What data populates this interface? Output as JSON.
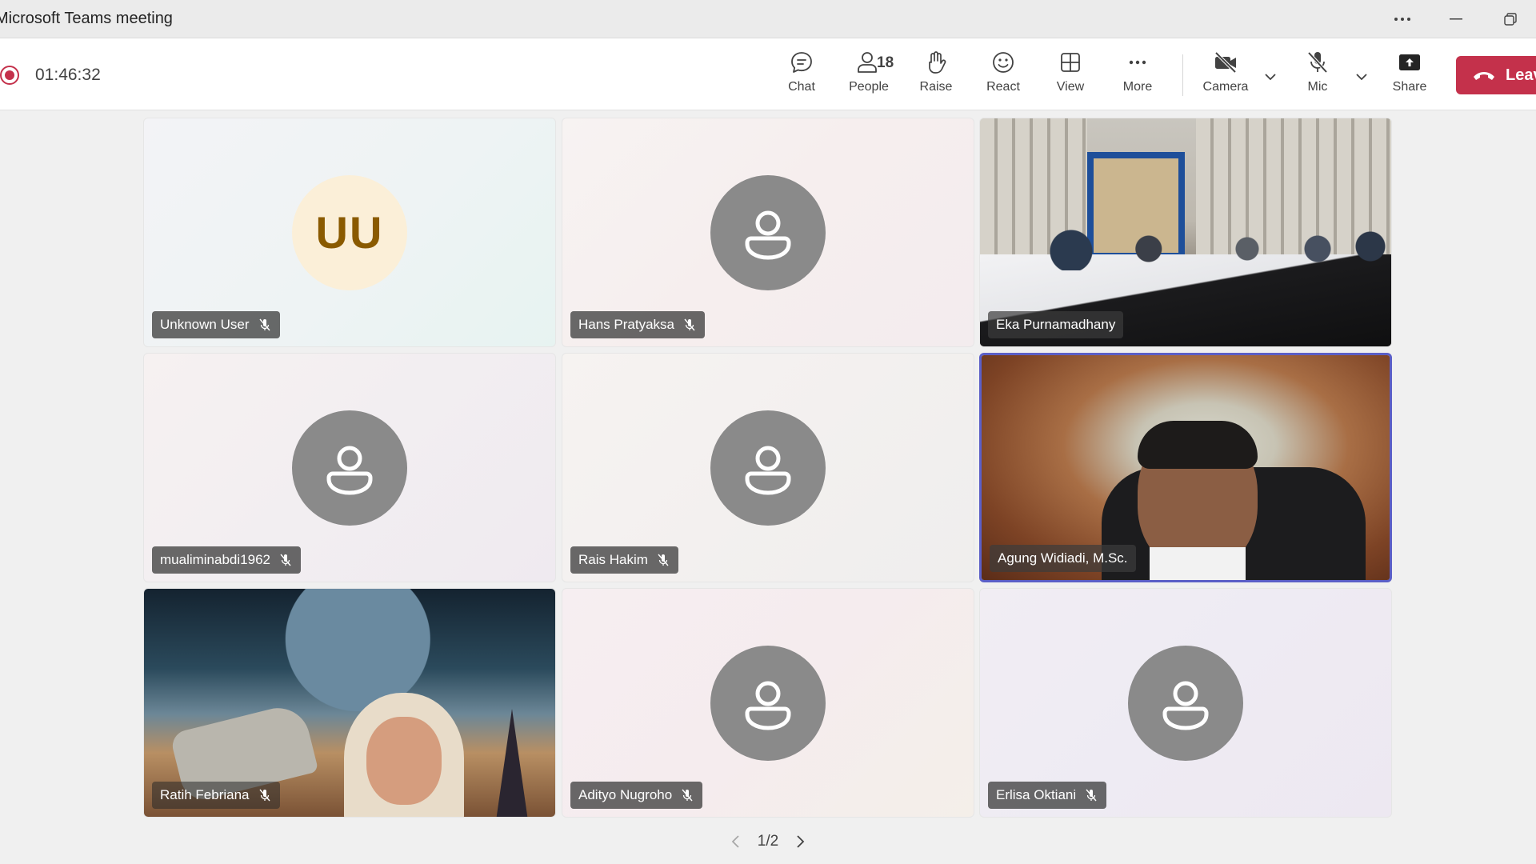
{
  "window": {
    "title": "Microsoft Teams meeting"
  },
  "meeting": {
    "elapsed": "01:46:32"
  },
  "toolbar": {
    "chat": "Chat",
    "people": "People",
    "people_count": "18",
    "raise": "Raise",
    "react": "React",
    "view": "View",
    "more": "More",
    "camera": "Camera",
    "mic": "Mic",
    "share": "Share",
    "leave": "Leave"
  },
  "participants": [
    {
      "name": "Unknown User",
      "initials": "UU",
      "muted": true
    },
    {
      "name": "Hans Pratyaksa",
      "muted": true
    },
    {
      "name": "Eka Purnamadhany",
      "muted": false,
      "video": true
    },
    {
      "name": "mualiminabdi1962",
      "muted": true
    },
    {
      "name": "Rais Hakim",
      "muted": true
    },
    {
      "name": "Agung Widiadi, M.Sc.",
      "muted": false,
      "video": true,
      "active_speaker": true
    },
    {
      "name": "Ratih Febriana",
      "muted": true,
      "video": true
    },
    {
      "name": "Adityo Nugroho",
      "muted": true
    },
    {
      "name": "Erlisa Oktiani",
      "muted": true
    }
  ],
  "pagination": {
    "label": "1/2"
  },
  "colors": {
    "leave": "#c4314b",
    "active_border": "#5b5fc7",
    "recording": "#c4314b"
  }
}
